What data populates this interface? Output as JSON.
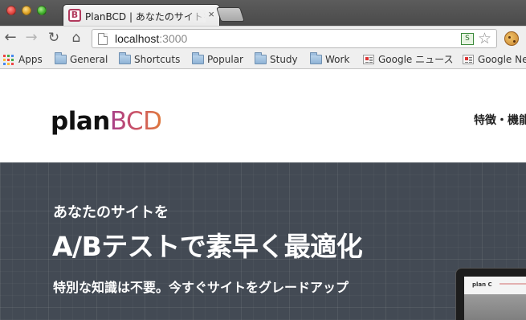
{
  "browser": {
    "tab": {
      "favicon_letter": "B",
      "title": "PlanBCD | あなたのサイトを",
      "close": "×"
    },
    "nav": {
      "back": "←",
      "forward": "→",
      "reload": "↻",
      "home": "⌂"
    },
    "address": {
      "host": "localhost",
      "port": ":3000"
    },
    "extension_label": "S",
    "star": "☆",
    "bookmarks": [
      {
        "label": "Apps",
        "icon": "apps-grid-icon"
      },
      {
        "label": "General",
        "icon": "folder-icon"
      },
      {
        "label": "Shortcuts",
        "icon": "folder-icon"
      },
      {
        "label": "Popular",
        "icon": "folder-icon"
      },
      {
        "label": "Study",
        "icon": "folder-icon"
      },
      {
        "label": "Work",
        "icon": "folder-icon"
      },
      {
        "label": "Google ニュース",
        "icon": "news-icon"
      },
      {
        "label": "Google News",
        "icon": "news-icon"
      }
    ]
  },
  "site": {
    "logo": {
      "plan": "plan",
      "bcd": "BCD"
    },
    "nav_item": "特徴・機能",
    "hero": {
      "tagline": "あなたのサイトを",
      "title": "A/Bテストで素早く最適化",
      "subtitle": "特別な知識は不要。今すぐサイトをグレードアップ"
    },
    "device_preview_logo": "plan C"
  },
  "colors": {
    "hero_bg": "#434a54",
    "brand_gradient_start": "#a63f8a",
    "brand_gradient_end": "#e07a3a",
    "favicon": "#b13a5d"
  }
}
